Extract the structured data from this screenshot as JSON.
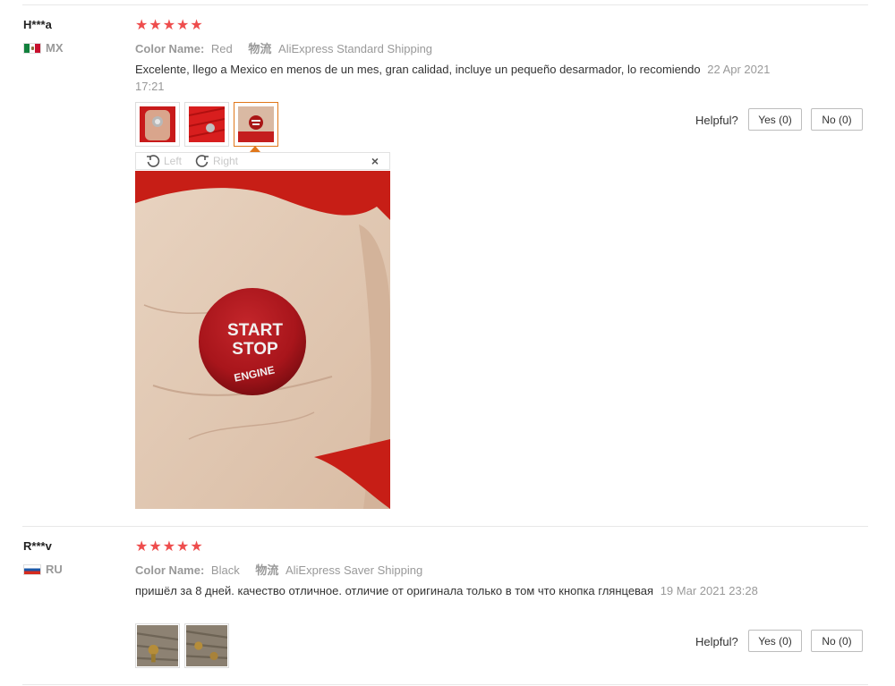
{
  "reviews": [
    {
      "user": "H***a",
      "country": "MX",
      "stars": "★★★★★",
      "color_label": "Color Name:",
      "color_value": "Red",
      "shipping_label": "物流",
      "shipping_value": "AliExpress Standard Shipping",
      "text": "Excelente, llego a Mexico en menos de un mes, gran calidad, incluye un pequeño desarmador, lo recomiendo",
      "date": "22 Apr 2021 17:21",
      "helpful_label": "Helpful?",
      "yes_label": "Yes (0)",
      "no_label": "No (0)",
      "viewer": {
        "left_label": "Left",
        "right_label": "Right",
        "close_label": "×",
        "button_lines": [
          "START",
          "STOP",
          "ENGINE"
        ]
      }
    },
    {
      "user": "R***v",
      "country": "RU",
      "stars": "★★★★★",
      "color_label": "Color Name:",
      "color_value": "Black",
      "shipping_label": "物流",
      "shipping_value": "AliExpress Saver Shipping",
      "text": "пришёл за 8 дней. качество отличное. отличие от оригинала только в том что кнопка глянцевая",
      "date": "19 Mar 2021 23:28",
      "helpful_label": "Helpful?",
      "yes_label": "Yes (0)",
      "no_label": "No (0)"
    }
  ],
  "colors": {
    "star": "#ee4d4d",
    "active_border": "#e0771b",
    "divider": "#e8e8e8"
  }
}
